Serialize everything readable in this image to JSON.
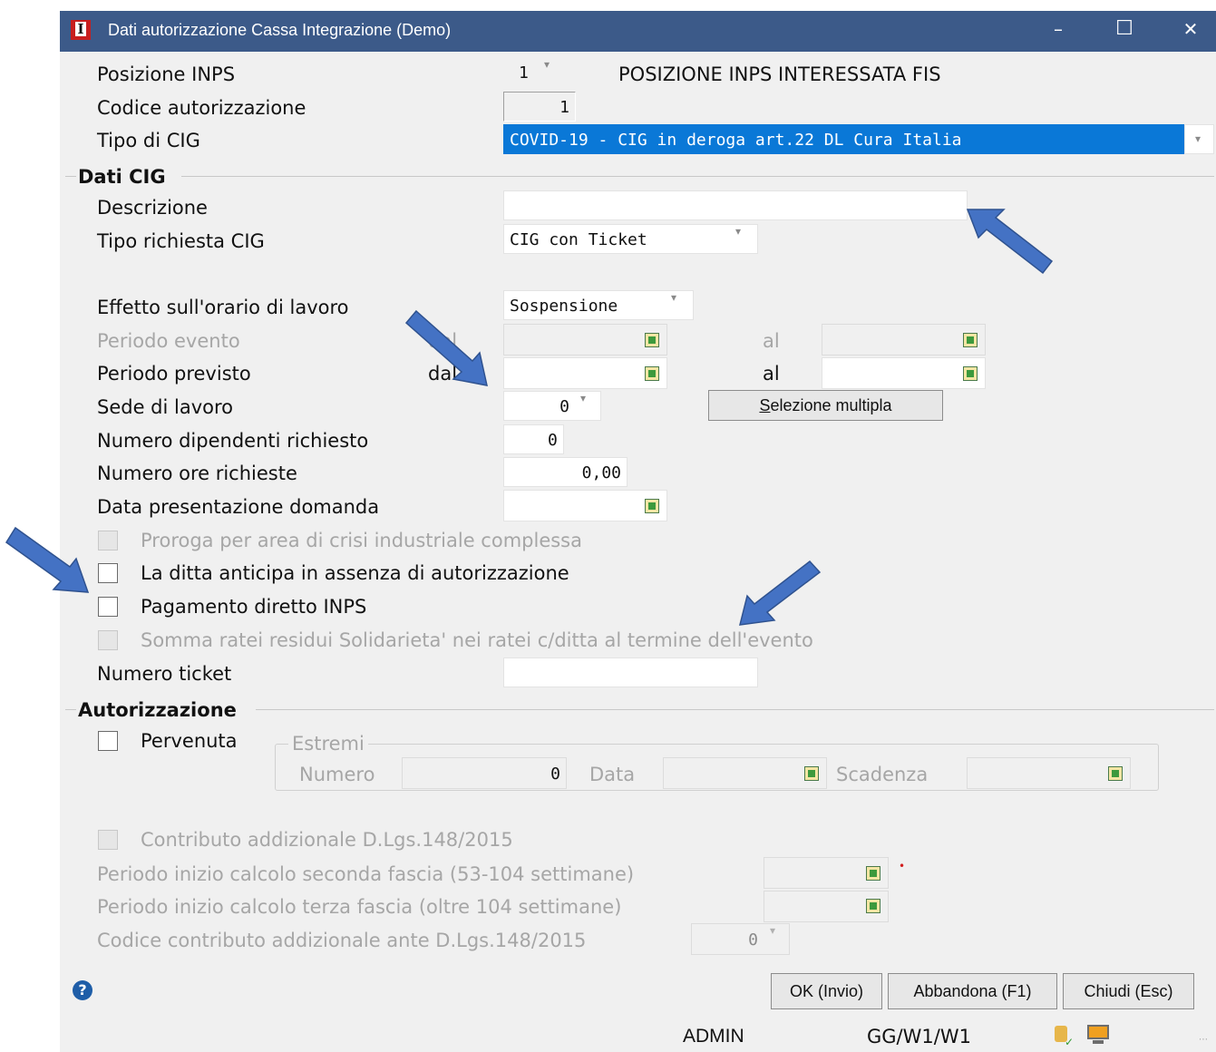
{
  "window": {
    "title": "Dati autorizzazione Cassa Integrazione  (Demo)",
    "minimize": "–",
    "maximize": "☐",
    "close": "✕"
  },
  "fields": {
    "posizione_inps": {
      "label": "Posizione INPS",
      "value": "1",
      "description": "POSIZIONE INPS INTERESSATA FIS"
    },
    "codice_autorizzazione": {
      "label": "Codice autorizzazione",
      "value": "1"
    },
    "tipo_cig": {
      "label": "Tipo di CIG",
      "value": "COVID-19 - CIG in deroga art.22 DL Cura Italia"
    }
  },
  "dati_cig": {
    "section_title": "Dati CIG",
    "descrizione": {
      "label": "Descrizione",
      "value": ""
    },
    "tipo_richiesta": {
      "label": "Tipo richiesta CIG",
      "value": "CIG con Ticket"
    },
    "effetto_orario": {
      "label": "Effetto sull'orario di lavoro",
      "value": "Sospensione"
    },
    "periodo_evento": {
      "label": "Periodo evento",
      "from_label": "dal",
      "to_label": "al",
      "from": "",
      "to": ""
    },
    "periodo_previsto": {
      "label": "Periodo previsto",
      "from_label": "dal",
      "to_label": "al",
      "from": "",
      "to": ""
    },
    "sede_lavoro": {
      "label": "Sede di lavoro",
      "value": "0",
      "button": "Selezione multipla",
      "button_underline": "S"
    },
    "numero_dipendenti": {
      "label": "Numero dipendenti richiesto",
      "value": "0"
    },
    "numero_ore": {
      "label": "Numero ore richieste",
      "value": "0,00"
    },
    "data_presentazione": {
      "label": "Data presentazione domanda",
      "value": ""
    },
    "checkboxes": [
      {
        "label": "Proroga per area di crisi industriale complessa",
        "checked": false,
        "disabled": true
      },
      {
        "label": "La ditta anticipa in assenza di autorizzazione",
        "checked": false,
        "disabled": false
      },
      {
        "label": "Pagamento diretto INPS",
        "checked": false,
        "disabled": false
      },
      {
        "label": "Somma ratei residui Solidarieta' nei ratei c/ditta al termine dell'evento",
        "checked": false,
        "disabled": true
      }
    ],
    "numero_ticket": {
      "label": "Numero ticket",
      "value": ""
    }
  },
  "autorizzazione": {
    "section_title": "Autorizzazione",
    "pervenuta": {
      "label": "Pervenuta",
      "checked": false
    },
    "estremi": {
      "group_title": "Estremi",
      "numero_label": "Numero",
      "numero_value": "0",
      "data_label": "Data",
      "data_value": "",
      "scadenza_label": "Scadenza",
      "scadenza_value": ""
    },
    "contributo": {
      "label": "Contributo addizionale D.Lgs.148/2015",
      "checked": false
    },
    "seconda_fascia": {
      "label": "Periodo inizio calcolo seconda fascia (53-104 settimane)",
      "value": ""
    },
    "required_mark": "•",
    "terza_fascia": {
      "label": "Periodo inizio calcolo terza fascia (oltre 104 settimane)",
      "value": ""
    },
    "codice_ante": {
      "label": "Codice contributo addizionale ante D.Lgs.148/2015",
      "value": "0"
    }
  },
  "buttons": {
    "ok": "OK (Invio)",
    "abbandona": "Abbandona (F1)",
    "chiudi": "Chiudi (Esc)"
  },
  "help_icon": "?",
  "status": {
    "user": "ADMIN",
    "code": "GG/W1/W1"
  },
  "colors": {
    "titlebar": "#3c5a89",
    "selection": "#0a78d7",
    "arrow": "#4472c4"
  }
}
